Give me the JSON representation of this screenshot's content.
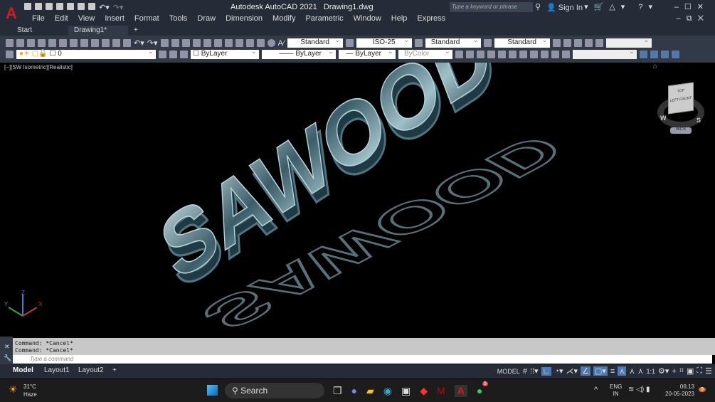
{
  "app": {
    "title": "Autodesk AutoCAD 2021",
    "file": "Drawing1.dwg",
    "search_placeholder": "Type a keyword or phrase",
    "sign_in": "Sign In"
  },
  "menu": [
    "File",
    "Edit",
    "View",
    "Insert",
    "Format",
    "Tools",
    "Draw",
    "Dimension",
    "Modify",
    "Parametric",
    "Window",
    "Help",
    "Express"
  ],
  "tabs": {
    "start": "Start",
    "drawing": "Drawing1*",
    "add": "+"
  },
  "toolbar": {
    "text_style": "Standard",
    "dim_style": "ISO-25",
    "table_style": "Standard",
    "mleader_style": "Standard",
    "layer": "0",
    "color": "ByLayer",
    "linetype": "ByLayer",
    "lineweight": "ByLayer",
    "plotstyle": "ByColor"
  },
  "viewport": {
    "label": "[−][SW Isometric][Realistic]",
    "text": "SAWOOD",
    "viewcube": {
      "top": "TOP",
      "left": "LEFT",
      "front": "FRONT",
      "w": "W",
      "s": "S",
      "wcs": "WCS"
    }
  },
  "command": {
    "history": [
      "Command: *Cancel*",
      "Command: *Cancel*"
    ],
    "placeholder": "Type a command"
  },
  "layouts": [
    "Model",
    "Layout1",
    "Layout2"
  ],
  "status": {
    "model": "MODEL",
    "scale": "1:1"
  },
  "taskbar": {
    "temp": "31°C",
    "weather": "Haze",
    "search": "Search",
    "lang1": "ENG",
    "lang2": "IN",
    "time": "06:13",
    "date": "20-05-2023",
    "whatsapp_badge": "5",
    "notif": "9"
  }
}
